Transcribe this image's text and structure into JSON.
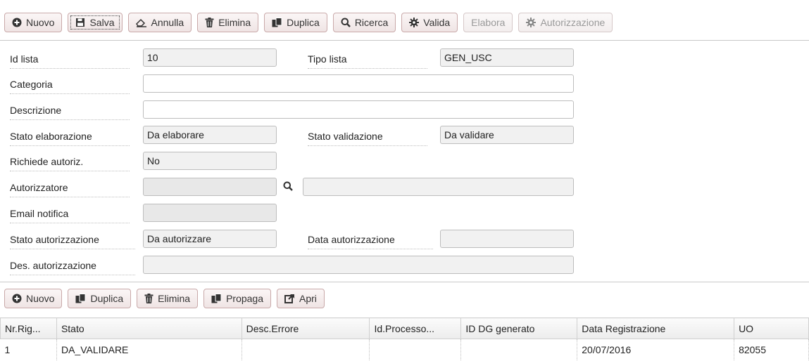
{
  "toolbar": {
    "buttons": [
      {
        "label": "Nuovo",
        "icon": "plus-circle-icon"
      },
      {
        "label": "Salva",
        "icon": "floppy-icon"
      },
      {
        "label": "Annulla",
        "icon": "eraser-icon"
      },
      {
        "label": "Elimina",
        "icon": "trash-icon"
      },
      {
        "label": "Duplica",
        "icon": "copy-icon"
      },
      {
        "label": "Ricerca",
        "icon": "search-icon"
      },
      {
        "label": "Valida",
        "icon": "gear-icon"
      },
      {
        "label": "Elabora",
        "icon": ""
      },
      {
        "label": "Autorizzazione",
        "icon": "gear-icon"
      }
    ]
  },
  "form": {
    "id_lista": {
      "label": "Id lista",
      "value": "10"
    },
    "tipo_lista": {
      "label": "Tipo lista",
      "value": "GEN_USC"
    },
    "categoria": {
      "label": "Categoria",
      "value": ""
    },
    "descrizione": {
      "label": "Descrizione",
      "value": ""
    },
    "stato_elaborazione": {
      "label": "Stato elaborazione",
      "value": "Da elaborare"
    },
    "stato_validazione": {
      "label": "Stato validazione",
      "value": "Da validare"
    },
    "richiede_autoriz": {
      "label": "Richiede autoriz.",
      "value": "No"
    },
    "autorizzatore": {
      "label": "Autorizzatore",
      "value": "",
      "desc": ""
    },
    "email_notifica": {
      "label": "Email notifica",
      "value": ""
    },
    "stato_autorizzazione": {
      "label": "Stato autorizzazione",
      "value": "Da autorizzare"
    },
    "data_autorizzazione": {
      "label": "Data autorizzazione",
      "value": ""
    },
    "des_autorizzazione": {
      "label": "Des. autorizzazione",
      "value": ""
    }
  },
  "detail_toolbar": {
    "buttons": [
      {
        "label": "Nuovo",
        "icon": "plus-circle-icon"
      },
      {
        "label": "Duplica",
        "icon": "copy-icon"
      },
      {
        "label": "Elimina",
        "icon": "trash-icon"
      },
      {
        "label": "Propaga",
        "icon": "copy-icon"
      },
      {
        "label": "Apri",
        "icon": "external-link-icon"
      }
    ]
  },
  "grid": {
    "columns": [
      "Nr.Rig...",
      "Stato",
      "Desc.Errore",
      "Id.Processo...",
      "ID DG generato",
      "Data Registrazione",
      "UO"
    ],
    "rows": [
      [
        "1",
        "DA_VALIDARE",
        "",
        "",
        "",
        "20/07/2016",
        "82055"
      ]
    ]
  }
}
